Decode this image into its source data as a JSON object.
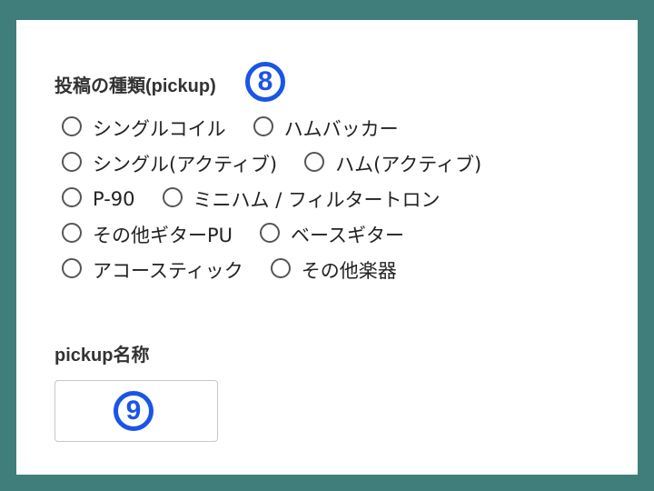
{
  "post_type": {
    "label": "投稿の種類(pickup)",
    "marker": "8",
    "options": [
      "シングルコイル",
      "ハムバッカー",
      "シングル(アクティブ)",
      "ハム(アクティブ)",
      "P-90",
      "ミニハム / フィルタートロン",
      "その他ギターPU",
      "ベースギター",
      "アコースティック",
      "その他楽器"
    ]
  },
  "pickup_name": {
    "label": "pickup名称",
    "marker": "9",
    "value": ""
  },
  "colors": {
    "background": "#3f7e7a",
    "panel": "#ffffff",
    "marker_accent": "#1a55e6"
  }
}
